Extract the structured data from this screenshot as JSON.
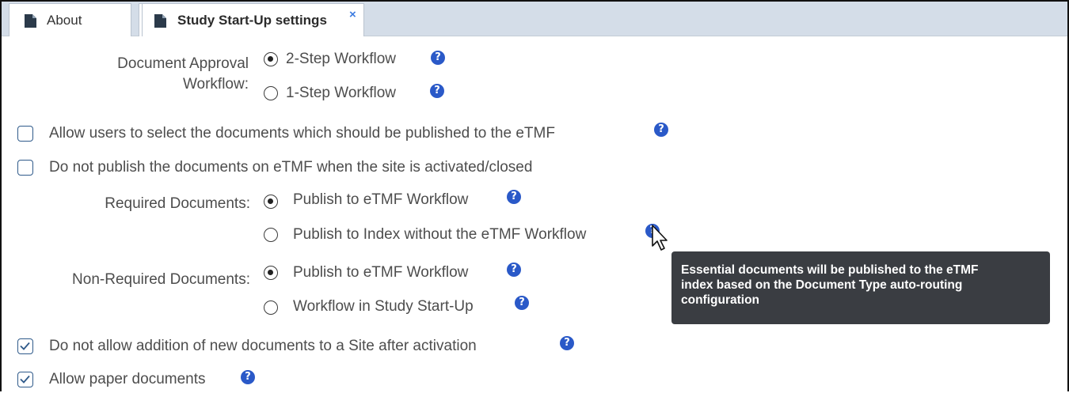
{
  "tabs": [
    {
      "label": "About",
      "icon": "document-icon"
    },
    {
      "label": "Study Start-Up settings",
      "icon": "document-icon",
      "close": "×",
      "active": true
    }
  ],
  "approval": {
    "label_line1": "Document Approval",
    "label_line2": "Workflow:",
    "options": [
      {
        "label": "2-Step Workflow",
        "selected": true
      },
      {
        "label": "1-Step Workflow",
        "selected": false
      }
    ]
  },
  "allow_select": {
    "label": "Allow users to select the documents which should be published to the eTMF",
    "checked": false
  },
  "no_publish": {
    "label": "Do not publish the documents on eTMF when the site is activated/closed",
    "checked": false
  },
  "required": {
    "label": "Required Documents:",
    "options": [
      {
        "label": "Publish to eTMF Workflow",
        "selected": true
      },
      {
        "label": "Publish to Index without the eTMF Workflow",
        "selected": false
      }
    ]
  },
  "non_required": {
    "label": "Non-Required Documents:",
    "options": [
      {
        "label": "Publish to eTMF Workflow",
        "selected": true
      },
      {
        "label": "Workflow in Study Start-Up",
        "selected": false
      }
    ]
  },
  "no_addition": {
    "label": "Do not allow addition of new documents to a Site after activation",
    "checked": true
  },
  "paper_docs": {
    "label": "Allow paper documents",
    "checked": true
  },
  "tooltip": {
    "line1": "Essential documents will be published to the eTMF",
    "line2": "index based on the Document Type auto-routing",
    "line3": "configuration"
  },
  "help_glyph": "?",
  "colors": {
    "accent": "#2a59c8",
    "tabbar": "#d4dde8",
    "tooltip_bg": "#3a3d42"
  }
}
